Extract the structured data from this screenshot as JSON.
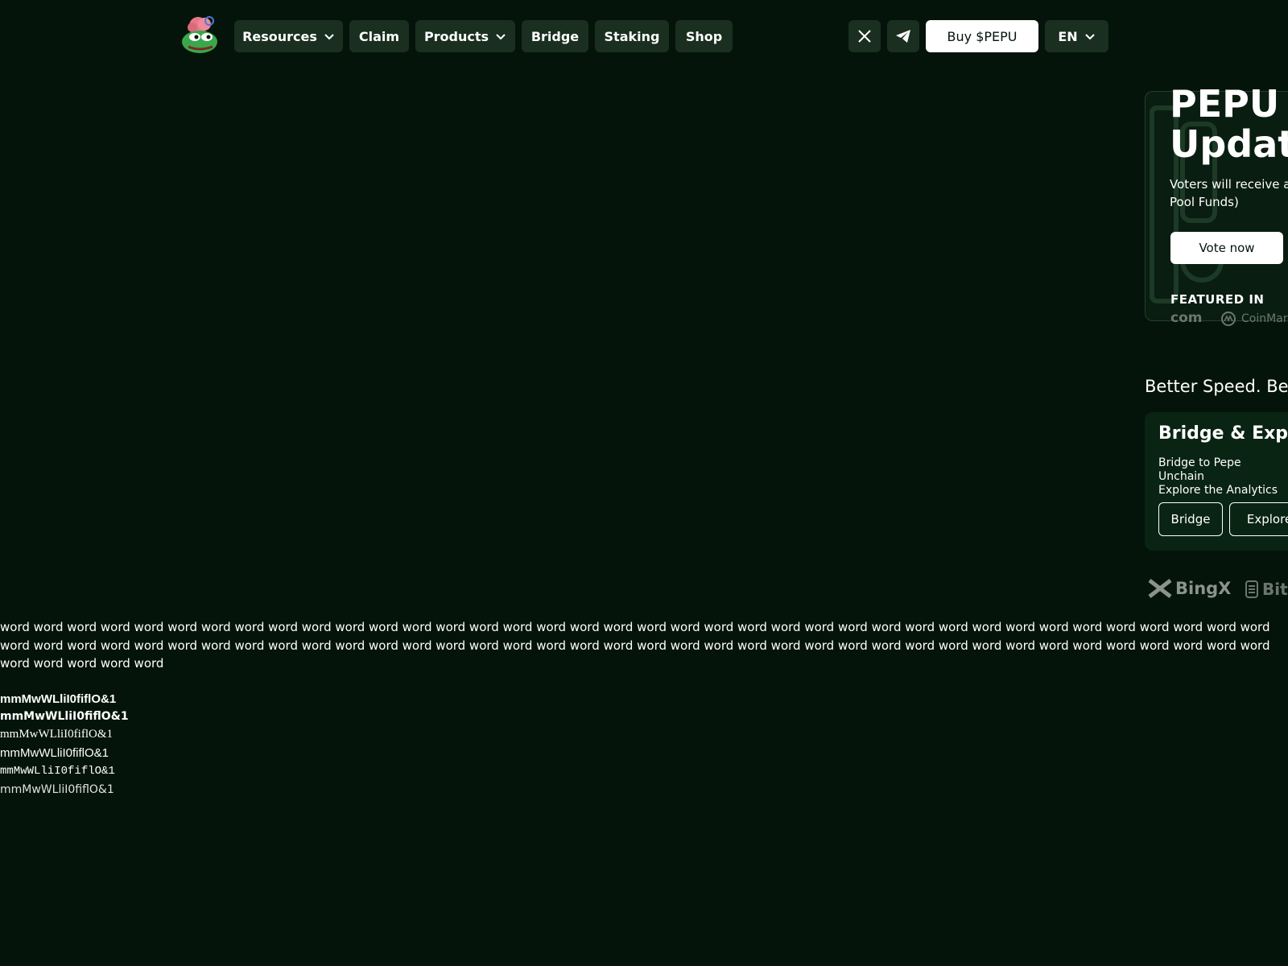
{
  "header": {
    "nav": {
      "resources": "Resources",
      "claim": "Claim",
      "products": "Products",
      "bridge": "Bridge",
      "staking": "Staking",
      "shop": "Shop"
    },
    "buy_label": "Buy $PEPU",
    "language": "EN"
  },
  "hero": {
    "title_line1": "PEPU R",
    "title_line2": "Update",
    "description": "Voters will receive a\nPool Funds)",
    "vote_label": "Vote now",
    "featured_label": "FEATURED IN",
    "featured_logos": [
      "com",
      "CoinMarl"
    ]
  },
  "tagline": "Better Speed. Bett",
  "bridge_card": {
    "title": "Bridge & Explore",
    "description": "Bridge to Pepe Unchain\nExplore the Analytics",
    "bridge_label": "Bridge",
    "explore_label": "Explore"
  },
  "exchanges": [
    "BingX",
    "BitM"
  ],
  "font_test": {
    "words": "word word word word word word word word word word word word word word word word word word word word word word word word word word word word word word word word word word word word word word word word word word word word word word word word word word word word word word word word word word word word word word word word word word word word word word word word word word word word word word word word word",
    "samples": [
      "mmMwWLliI0fiflO&1",
      "mmMwWLliI0fiflO&1",
      "mmMwWLliI0fiflO&1",
      "mmMwWLliI0fiflO&1",
      "mmMwWLliI0fiflO&1",
      "mmMwWLliI0fiflO&1"
    ]
  },
  "colors": {
    "background": "#04140b",
    "button_dark": "#1a2f1f",
    "accent_white": "#ffffff"
  }
}
